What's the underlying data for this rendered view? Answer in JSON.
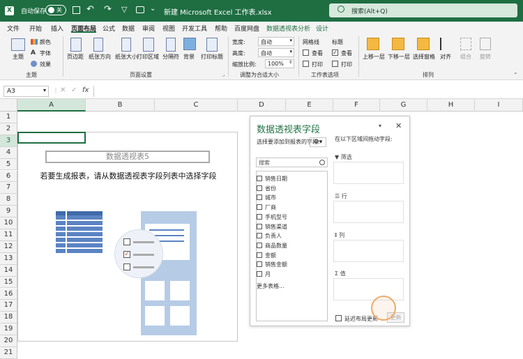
{
  "title_bar": {
    "autosave_label": "自动保存",
    "autosave_state": "关",
    "doc_title": "新建 Microsoft Excel 工作表.xlsx",
    "search_placeholder": "搜索(Alt+Q)"
  },
  "menu": [
    "文件",
    "开始",
    "插入",
    "页面布局",
    "公式",
    "数据",
    "审阅",
    "视图",
    "开发工具",
    "帮助",
    "百度网盘",
    "数据透视表分析",
    "设计"
  ],
  "menu_active": "页面布局",
  "ribbon": {
    "theme": {
      "main": "主题",
      "colors": "颜色",
      "fonts": "字体",
      "effects": "效果",
      "group": "主题"
    },
    "page_setup": {
      "items": [
        "页边距",
        "纸张方向",
        "纸张大小",
        "打印区域",
        "分隔符",
        "背景",
        "打印标题"
      ],
      "group": "页面设置"
    },
    "scale": {
      "width_label": "宽度:",
      "width_value": "自动",
      "height_label": "高度:",
      "height_value": "自动",
      "zoom_label": "缩放比例:",
      "zoom_value": "100%",
      "group": "调整为合适大小"
    },
    "sheet_options": {
      "gridlines": "网格线",
      "headings": "标题",
      "view": "查看",
      "print": "打印",
      "group": "工作表选项"
    },
    "arrange": {
      "items": [
        "上移一层",
        "下移一层",
        "选择窗格",
        "对齐",
        "组合",
        "旋转"
      ],
      "group": "排列"
    }
  },
  "formula_bar": {
    "name_box": "A3",
    "fx": "fx"
  },
  "columns": [
    "A",
    "B",
    "C",
    "D",
    "E",
    "F",
    "G",
    "H",
    "I"
  ],
  "rows": [
    "1",
    "2",
    "3",
    "4",
    "5",
    "6",
    "7",
    "8",
    "9",
    "10",
    "11",
    "12",
    "13",
    "14",
    "15",
    "16",
    "17",
    "18",
    "19",
    "20",
    "21"
  ],
  "pivot_placeholder": {
    "name": "数据透视表5",
    "instruction": "若要生成报表，请从数据透视表字段列表中选择字段"
  },
  "pivot_pane": {
    "title": "数据透视表字段",
    "choose_text": "选择要添加到报表的字段:",
    "search_placeholder": "搜索",
    "fields": [
      "销售日期",
      "省份",
      "城市",
      "厂商",
      "手机型号",
      "销售渠道",
      "负责人",
      "商品数量",
      "金额",
      "销售金额",
      "月"
    ],
    "more_tables": "更多表格...",
    "drag_text": "在以下区域间拖动字段:",
    "zones": {
      "filter": "筛选",
      "rows": "行",
      "columns": "列",
      "values": "值"
    },
    "defer_update": "延迟布局更新",
    "update_button": "更新"
  },
  "colors": {
    "excel_green": "#1e6e42",
    "pivot_title": "#217346",
    "illustration_blue": "#5b84c4",
    "cursor_ring": "#f0a868"
  }
}
